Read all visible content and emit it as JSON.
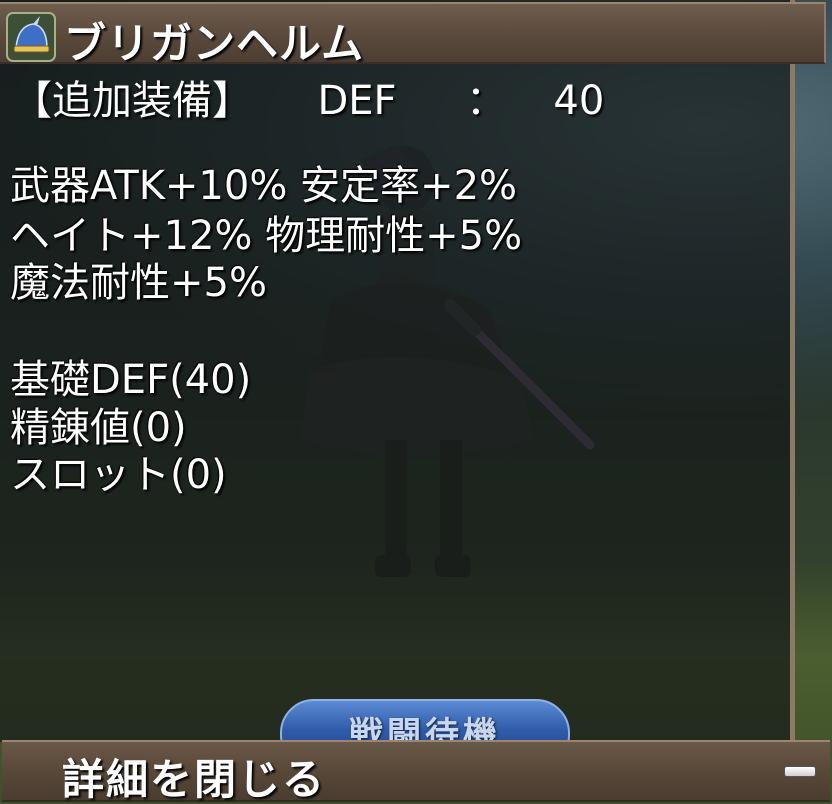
{
  "item": {
    "name": "ブリガンヘルム",
    "icon": "helmet-icon"
  },
  "slot_line": {
    "slot": "【追加装備】",
    "stat": "DEF",
    "separator": "：",
    "value": "40"
  },
  "effects": [
    "武器ATK+10%  安定率+2%",
    "ヘイト+12%  物理耐性+5%",
    "魔法耐性+5%"
  ],
  "base_stats": [
    "基礎DEF(40)",
    "精錬値(0)",
    "スロット(0)"
  ],
  "battle_button": {
    "label": "戦闘待機"
  },
  "footer": {
    "close_label": "詳細を閉じる",
    "collapse_icon": "minus-icon"
  },
  "colors": {
    "panel_frame": "#8d7a63",
    "header_bg": "#5a4a3c",
    "text": "#ffffff",
    "button_blue": "#2e5ba8"
  }
}
